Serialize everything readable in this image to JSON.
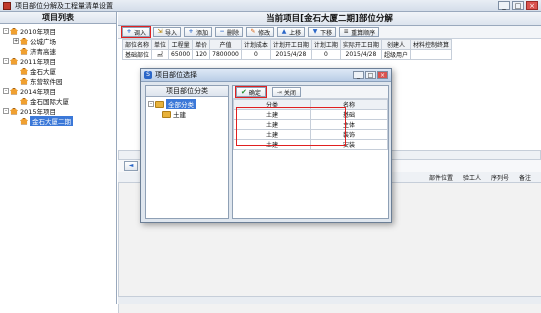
{
  "window": {
    "title": "项目部位分解及工程量清单设置",
    "buttons": [
      "_",
      "□",
      "×"
    ]
  },
  "left_panel": {
    "title": "项目列表",
    "tree": [
      {
        "label": "2010年项目",
        "level": 0,
        "box": "-"
      },
      {
        "label": "公城广场",
        "level": 1,
        "box": "+"
      },
      {
        "label": "济青高速",
        "level": 1,
        "box": ""
      },
      {
        "label": "2011年项目",
        "level": 0,
        "box": "-"
      },
      {
        "label": "金石大厦",
        "level": 1,
        "box": ""
      },
      {
        "label": "东营软件园",
        "level": 1,
        "box": ""
      },
      {
        "label": "2014年项目",
        "level": 0,
        "box": "-"
      },
      {
        "label": "金石国际大厦",
        "level": 1,
        "box": ""
      },
      {
        "label": "2015年项目",
        "level": 0,
        "box": "-"
      },
      {
        "label": "金石大厦二期",
        "level": 1,
        "box": "",
        "selected": true
      }
    ]
  },
  "main": {
    "title": "当前项目[金石大厦二期]部位分解",
    "toolbar": [
      "调入",
      "导入",
      "添加",
      "删除",
      "修改",
      "上移",
      "下移",
      "重算顺序"
    ],
    "columns": [
      "部位名称",
      "单位",
      "工程量",
      "单价",
      "产值",
      "计划成本",
      "计划开工日期",
      "计划工期",
      "实际开工日期",
      "创建人",
      "材料控制终算"
    ],
    "rows": [
      [
        "基础部位",
        "㎡",
        "65000",
        "120",
        "7800000",
        "0",
        "2015/4/28",
        "0",
        "2015/4/28",
        "超级用户",
        ""
      ]
    ],
    "lower_columns": [
      "部件位置",
      "验工人",
      "序列号",
      "备注"
    ]
  },
  "dialog": {
    "title": "项目部位选择",
    "tree_title": "项目部位分类",
    "tree": [
      {
        "label": "全部分类",
        "selected": true
      },
      {
        "label": "土建",
        "selected": false
      }
    ],
    "buttons": {
      "confirm": "确定",
      "close": "关闭"
    },
    "columns": [
      "分类",
      "名称"
    ],
    "rows": [
      [
        "土建",
        "基础"
      ],
      [
        "土建",
        "主体"
      ],
      [
        "土建",
        "装饰"
      ],
      [
        "土建",
        "安装"
      ]
    ]
  }
}
